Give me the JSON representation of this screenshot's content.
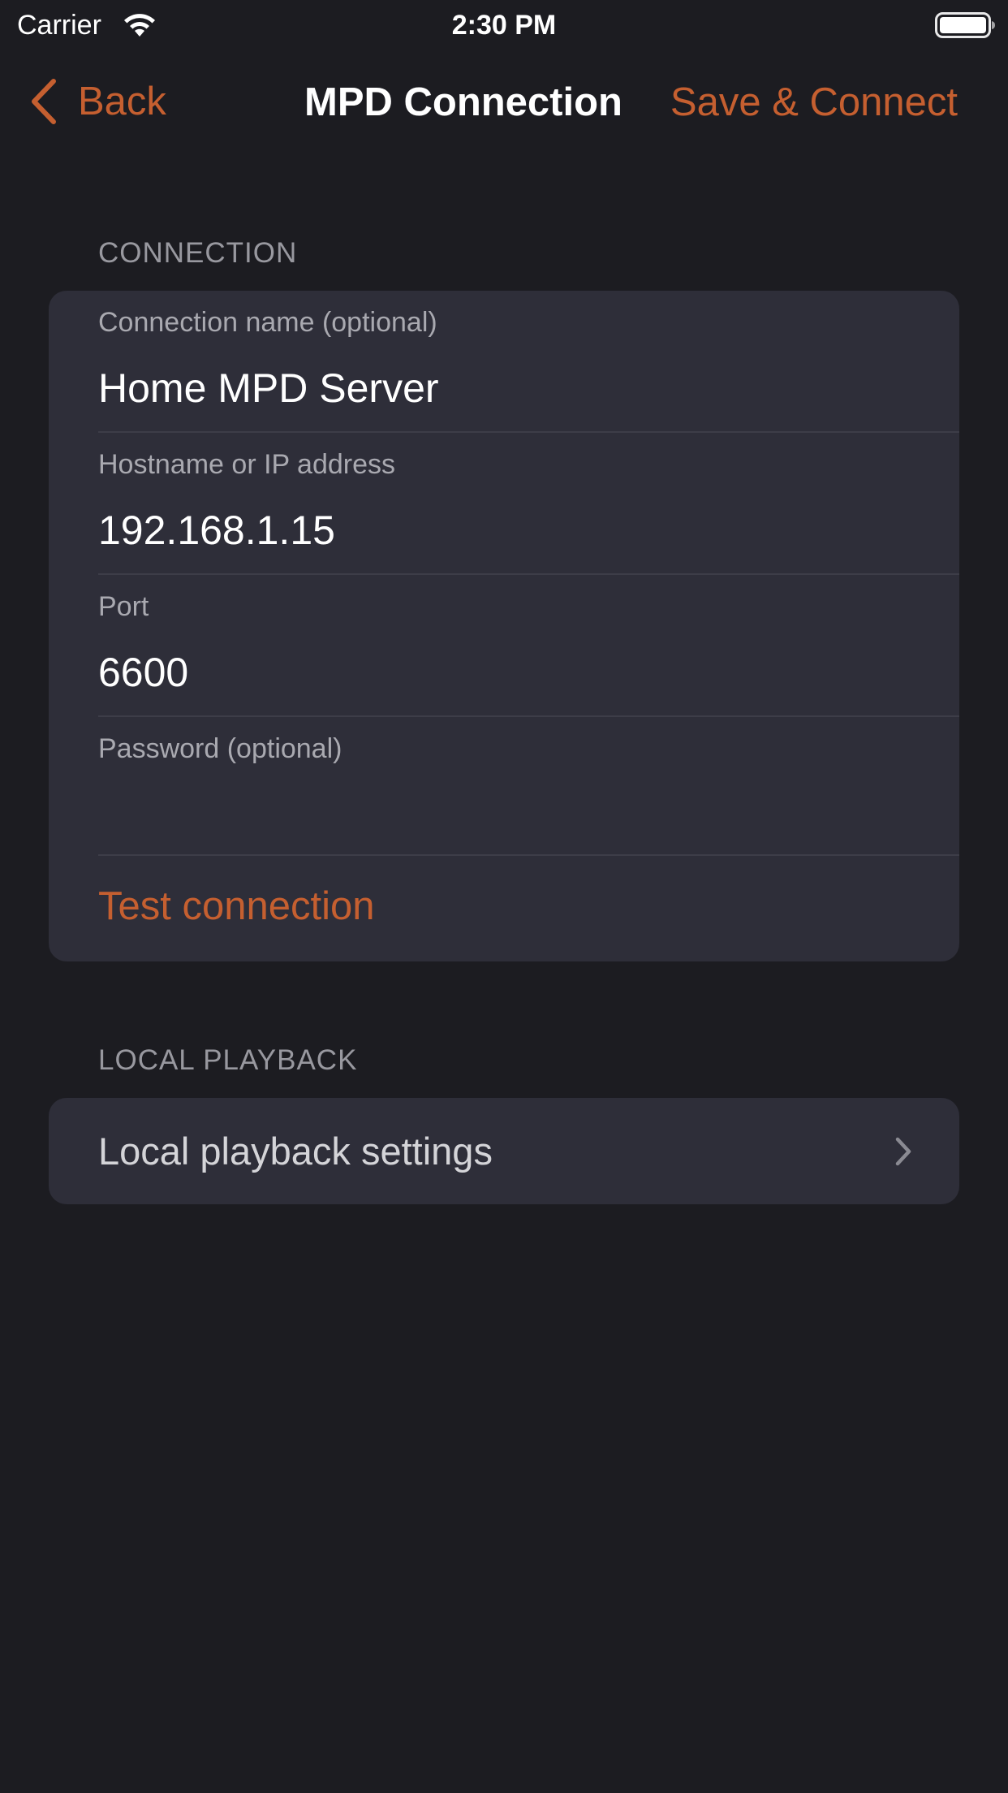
{
  "status_bar": {
    "carrier": "Carrier",
    "time": "2:30 PM"
  },
  "nav": {
    "back_label": "Back",
    "title": "MPD Connection",
    "save_label": "Save & Connect"
  },
  "connection_section": {
    "header": "CONNECTION",
    "fields": [
      {
        "label": "Connection name (optional)",
        "value": "Home MPD Server"
      },
      {
        "label": "Hostname or IP address",
        "value": "192.168.1.15"
      },
      {
        "label": "Port",
        "value": "6600"
      },
      {
        "label": "Password (optional)",
        "value": ""
      }
    ],
    "test_label": "Test connection"
  },
  "local_section": {
    "header": "LOCAL PLAYBACK",
    "row_label": "Local playback settings"
  },
  "colors": {
    "accent": "#c55f30",
    "background": "#1c1c21",
    "group_background": "#2e2e39"
  },
  "icons": [
    "wifi-icon",
    "battery-icon",
    "chevron-left-icon",
    "chevron-right-icon"
  ]
}
